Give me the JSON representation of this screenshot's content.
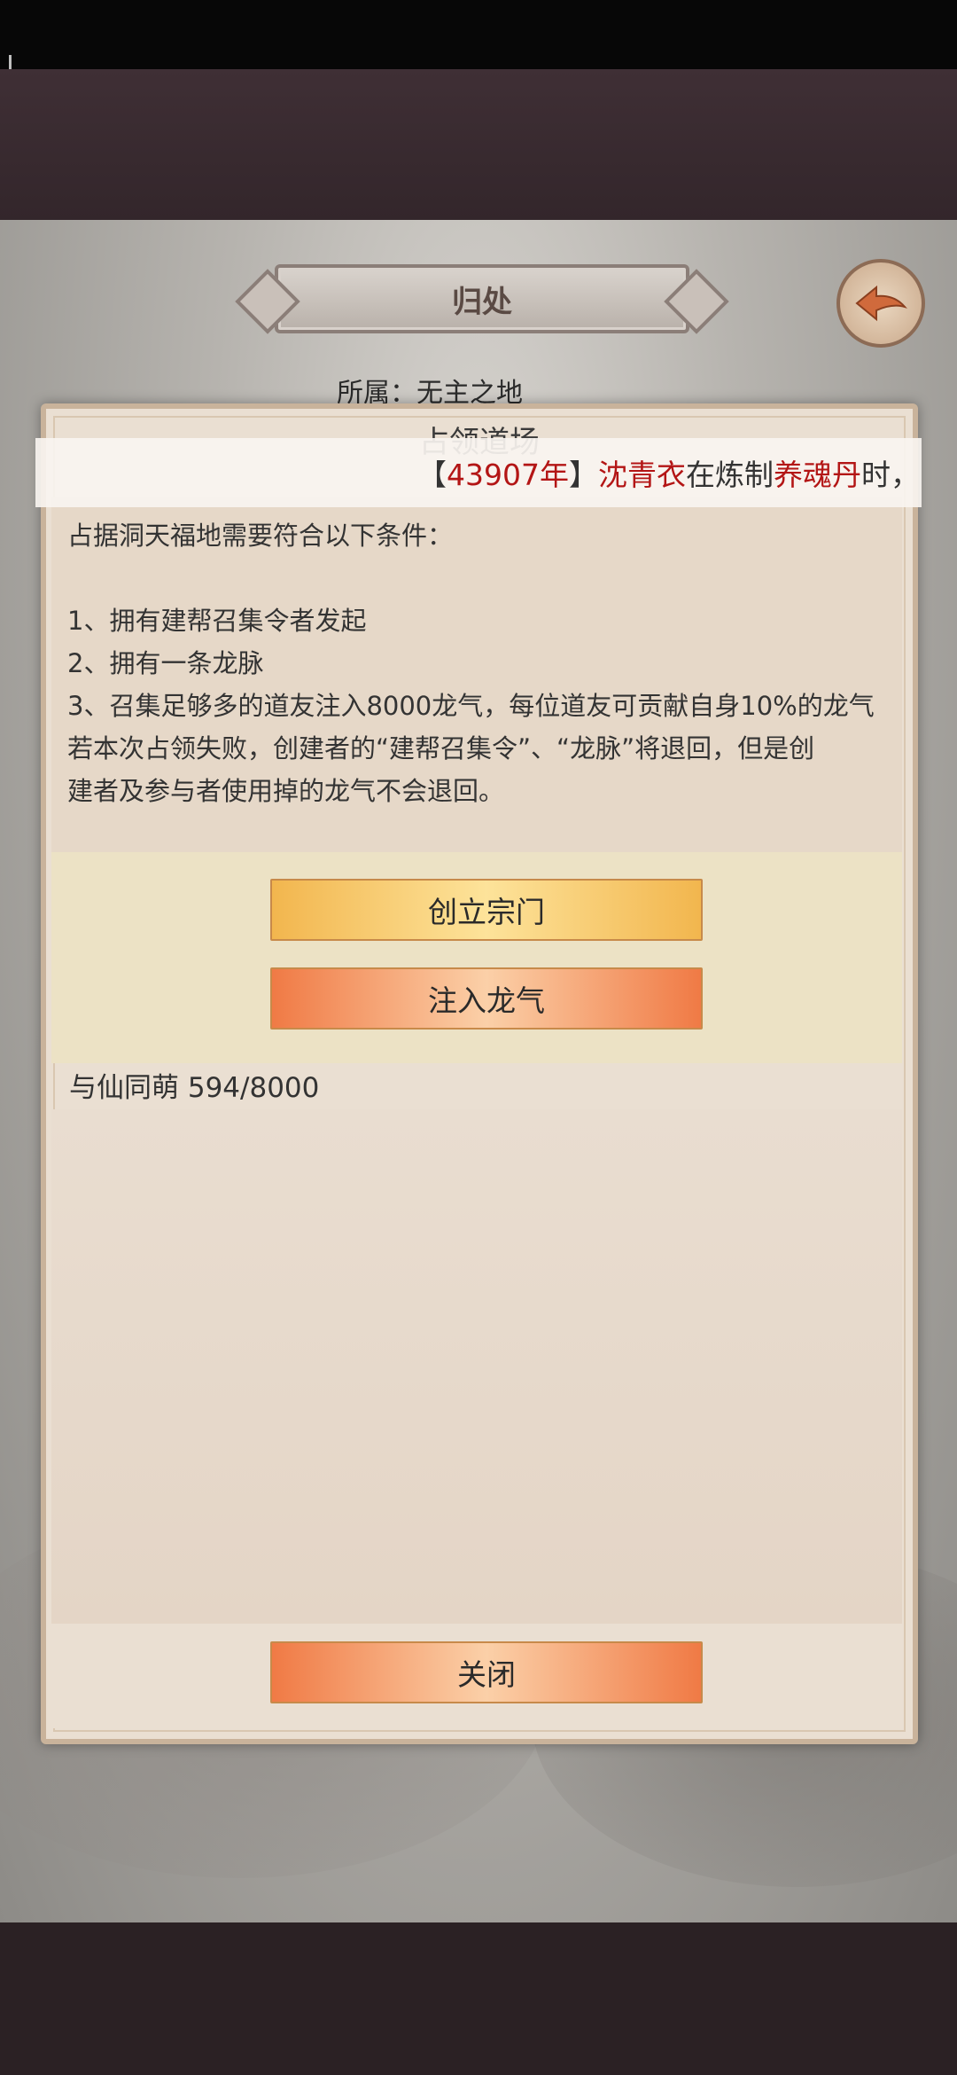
{
  "header": {
    "title": "归处",
    "back_icon": "back-arrow-icon"
  },
  "affiliation": "所属：无主之地",
  "dialog": {
    "title": "占领道场",
    "description": [
      "占据洞天福地需要符合以下条件：",
      "",
      "1、拥有建帮召集令者发起",
      "2、拥有一条龙脉",
      "3、召集足够多的道友注入8000龙气，每位道友可贡献自身10%的龙气",
      "若本次占领失败，创建者的“建帮召集令”、“龙脉”将退回，但是创",
      "建者及参与者使用掉的龙气不会退回。"
    ],
    "found_sect_label": "创立宗门",
    "inject_label": "注入龙气",
    "progress_text": "与仙同萌 594/8000",
    "close_label": "关闭"
  },
  "ticker": {
    "bracket_open": "【",
    "year": "43907年",
    "bracket_close": "】",
    "name": "沈青衣",
    "mid": "在炼制",
    "item": "养魂丹",
    "tail": "时，"
  },
  "colors": {
    "highlight_red": "#b31515",
    "gold_button": "#f2b64e",
    "orange_button": "#f07a45"
  }
}
